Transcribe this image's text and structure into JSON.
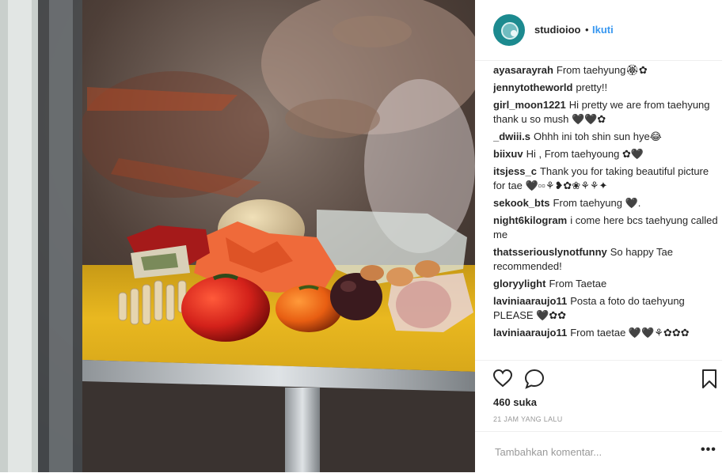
{
  "post": {
    "username": "studioioo",
    "separator": "•",
    "follow_label": "Ikuti",
    "likes": "460 suka",
    "timestamp": "21 JAM YANG LALU",
    "comment_placeholder": "Tambahkan komentar...",
    "more_label": "•••"
  },
  "comments": [
    {
      "user": "ayasarayrah",
      "text": "From taehyung🏵✿"
    },
    {
      "user": "jennytotheworld",
      "text": "pretty!!"
    },
    {
      "user": "girl_moon1221",
      "text": "Hi pretty we are from taehyung thank u so mush 🖤🖤✿"
    },
    {
      "user": "_dwiii.s",
      "text": "Ohhh ini toh shin sun hye😂"
    },
    {
      "user": "biixuv",
      "text": "Hi , From taehyoung ✿🖤"
    },
    {
      "user": "itsjess_c",
      "text": "Thank you for taking beautiful picture for tae 🖤▫▫⚘❥✿❀⚘⚘✦"
    },
    {
      "user": "sekook_bts",
      "text": "From taehyung 🖤."
    },
    {
      "user": "night6kilogram",
      "text": "i come here bcs taehyung called me"
    },
    {
      "user": "thatsseriouslynotfunny",
      "text": "So happy Tae recommended!"
    },
    {
      "user": "gloryylight",
      "text": "From Taetae"
    },
    {
      "user": "laviniaaraujo11",
      "text": "Posta a foto do taehyung PLEASE 🖤✿✿"
    },
    {
      "user": "laviniaaraujo11",
      "text": "From taetae 🖤🖤⚘✿✿✿"
    }
  ],
  "icons": [
    "heart-icon",
    "comment-icon",
    "bookmark-icon"
  ],
  "colors": {
    "accent": "#3897f0",
    "avatar": "#1c8a8f",
    "table": "#e6b21d"
  }
}
